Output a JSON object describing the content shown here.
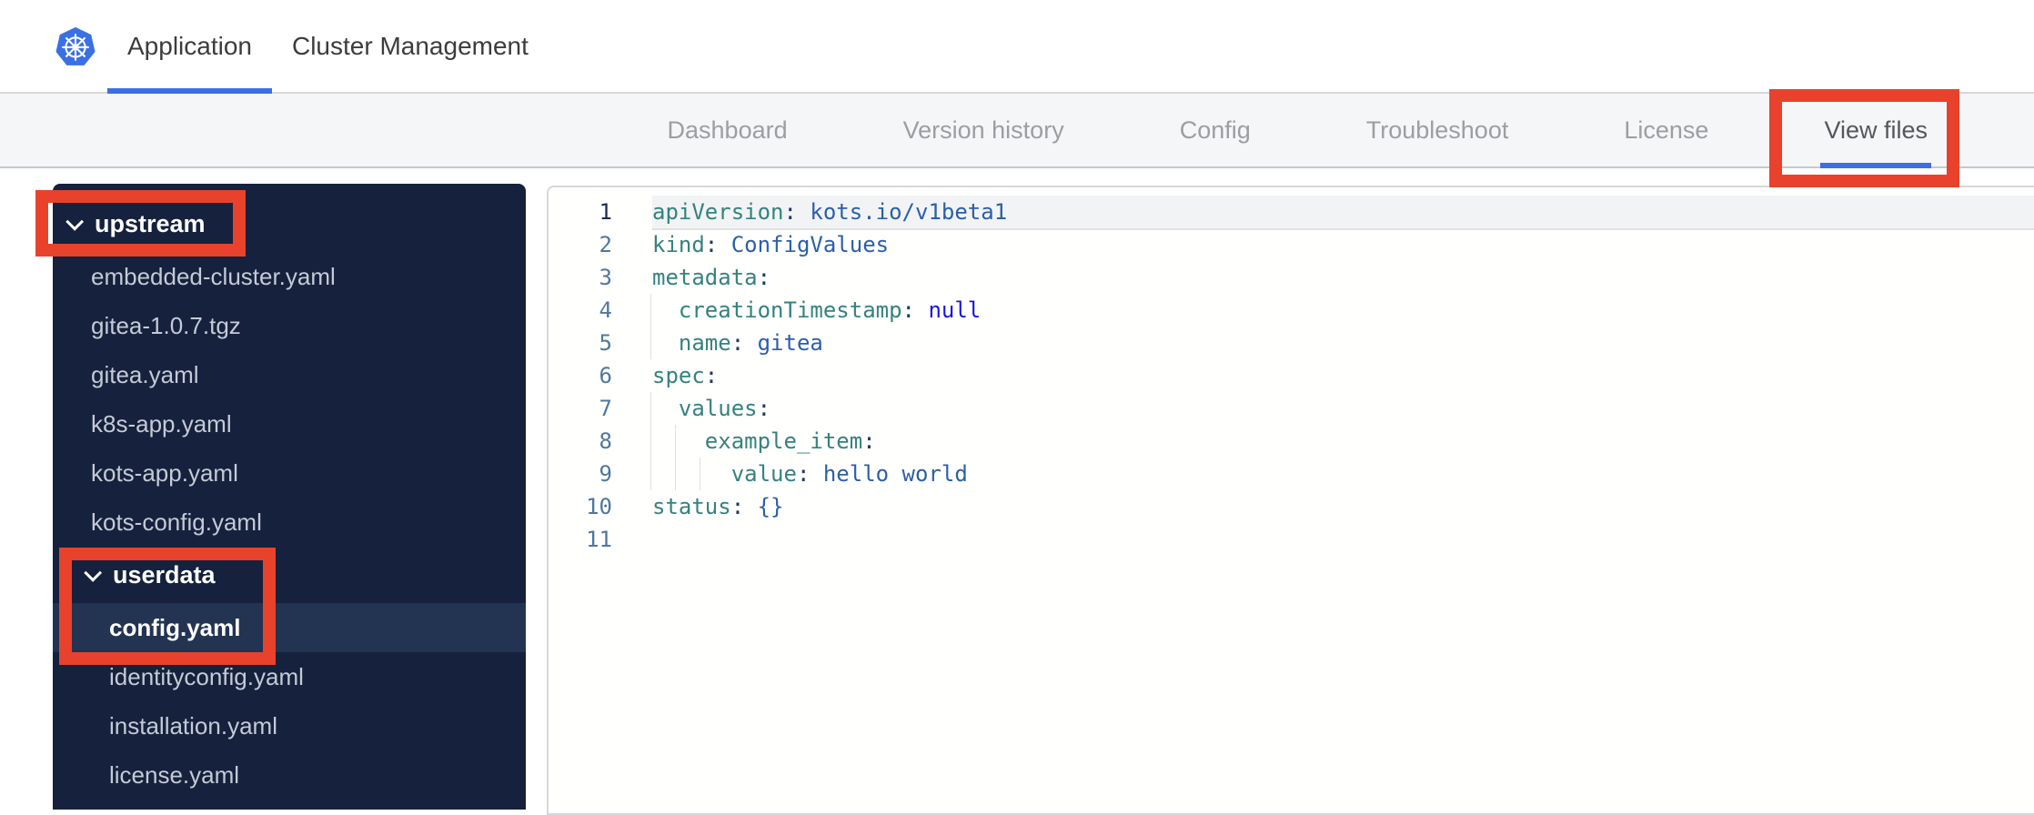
{
  "header": {
    "logo": "kubernetes-logo",
    "tabs": [
      {
        "label": "Application",
        "active": true
      },
      {
        "label": "Cluster Management",
        "active": false
      }
    ]
  },
  "nav": {
    "tabs": [
      {
        "label": "Dashboard",
        "active": false
      },
      {
        "label": "Version history",
        "active": false
      },
      {
        "label": "Config",
        "active": false
      },
      {
        "label": "Troubleshoot",
        "active": false
      },
      {
        "label": "License",
        "active": false
      },
      {
        "label": "View files",
        "active": true
      }
    ]
  },
  "file_tree": {
    "items": [
      {
        "label": "upstream",
        "type": "folder",
        "level": 1,
        "expanded": true
      },
      {
        "label": "embedded-cluster.yaml",
        "type": "file",
        "level": 1
      },
      {
        "label": "gitea-1.0.7.tgz",
        "type": "file",
        "level": 1
      },
      {
        "label": "gitea.yaml",
        "type": "file",
        "level": 1
      },
      {
        "label": "k8s-app.yaml",
        "type": "file",
        "level": 1
      },
      {
        "label": "kots-app.yaml",
        "type": "file",
        "level": 1
      },
      {
        "label": "kots-config.yaml",
        "type": "file",
        "level": 1
      },
      {
        "label": "userdata",
        "type": "folder",
        "level": 2,
        "expanded": true
      },
      {
        "label": "config.yaml",
        "type": "file",
        "level": 2,
        "selected": true
      },
      {
        "label": "identityconfig.yaml",
        "type": "file",
        "level": 2
      },
      {
        "label": "installation.yaml",
        "type": "file",
        "level": 2
      },
      {
        "label": "license.yaml",
        "type": "file",
        "level": 2
      }
    ]
  },
  "editor": {
    "active_line": 1,
    "lines": [
      {
        "n": 1,
        "guides": [],
        "segs": [
          [
            "k",
            "apiVersion"
          ],
          [
            "p",
            ": "
          ],
          [
            "v",
            "kots.io/v1beta1"
          ]
        ]
      },
      {
        "n": 2,
        "guides": [],
        "segs": [
          [
            "k",
            "kind"
          ],
          [
            "p",
            ": "
          ],
          [
            "v",
            "ConfigValues"
          ]
        ]
      },
      {
        "n": 3,
        "guides": [],
        "segs": [
          [
            "k",
            "metadata"
          ],
          [
            "p",
            ":"
          ]
        ]
      },
      {
        "n": 4,
        "guides": [
          0
        ],
        "segs": [
          [
            "w",
            "  "
          ],
          [
            "k",
            "creationTimestamp"
          ],
          [
            "p",
            ": "
          ],
          [
            "n",
            "null"
          ]
        ]
      },
      {
        "n": 5,
        "guides": [
          0
        ],
        "segs": [
          [
            "w",
            "  "
          ],
          [
            "k",
            "name"
          ],
          [
            "p",
            ": "
          ],
          [
            "v",
            "gitea"
          ]
        ]
      },
      {
        "n": 6,
        "guides": [],
        "segs": [
          [
            "k",
            "spec"
          ],
          [
            "p",
            ":"
          ]
        ]
      },
      {
        "n": 7,
        "guides": [
          0
        ],
        "segs": [
          [
            "w",
            "  "
          ],
          [
            "k",
            "values"
          ],
          [
            "p",
            ":"
          ]
        ]
      },
      {
        "n": 8,
        "guides": [
          0,
          1
        ],
        "segs": [
          [
            "w",
            "    "
          ],
          [
            "k",
            "example_item"
          ],
          [
            "p",
            ":"
          ]
        ]
      },
      {
        "n": 9,
        "guides": [
          0,
          1,
          2
        ],
        "segs": [
          [
            "w",
            "      "
          ],
          [
            "k",
            "value"
          ],
          [
            "p",
            ": "
          ],
          [
            "v",
            "hello world"
          ]
        ]
      },
      {
        "n": 10,
        "guides": [],
        "segs": [
          [
            "k",
            "status"
          ],
          [
            "p",
            ": "
          ],
          [
            "v",
            "{}"
          ]
        ]
      },
      {
        "n": 11,
        "guides": [],
        "segs": []
      }
    ]
  },
  "annotations": {
    "highlight_color": "#e8422c",
    "targets": [
      "view-files-tab",
      "upstream-folder",
      "userdata-and-config-yaml"
    ]
  },
  "colors": {
    "sidebar_bg": "#15213d",
    "sidebar_selected_bg": "#223452",
    "accent_blue": "#3e6ee3",
    "kubernetes_blue": "#3b70e4",
    "nav_bg": "#f5f6f7",
    "yaml_key": "#35827e",
    "yaml_value": "#2c5fa8",
    "yaml_keyword": "#1a17d8",
    "active_line_bg": "#f2f3f4"
  }
}
